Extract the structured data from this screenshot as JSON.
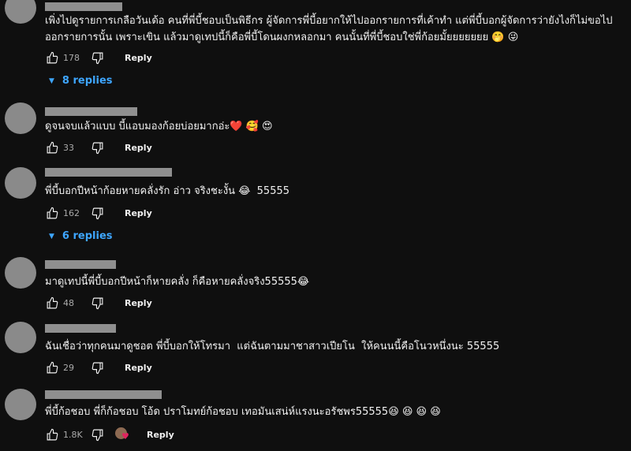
{
  "comments": [
    {
      "text": "เพิ่งไปดูรายการเกลือวันเด้อ คนที่พี่บี้ชอบเป็นพิธีกร ผู้จัดการพี่บี้อยากให้ไปออกรายการที่เค้าทำ แต่พี่บี้บอกผู้จัดการว่ายังไงก็ไม่ขอไปออกรายการนั้น เพราะเขิน แล้วมาดูเทปนี้ก็คือพี่บี้โดนผงกหลอกมา คนนั้นที่พี่บี้ชอบใช่พี่ก้อยมั้ยยยยยยย 🤭 😜",
      "likes": "178",
      "reply_label": "Reply",
      "replies_label": "8 replies"
    },
    {
      "text": "ดูจนจบแล้วแบบ บี้แอบมองก้อยบ่อยมากอ่ะ❤️ 🥰 😍",
      "likes": "33",
      "reply_label": "Reply"
    },
    {
      "text": "พี่บี้บอกปีหน้าก้อยหายคลั่งรัก อ่าว จริงชะงั้น 😂  55555",
      "likes": "162",
      "reply_label": "Reply",
      "replies_label": "6 replies"
    },
    {
      "text": "มาดูเทปนี้พี่บี้บอกปีหน้าก็หายคลั่ง ก็คือหายคลั่งจริง55555😂",
      "likes": "48",
      "reply_label": "Reply"
    },
    {
      "text": "ฉันเชื่อว่าทุกคนมาดูชอต พี่บี้บอกให้โทรมา  แต่ฉันตามมาชาสาวเปียโน  ให้คนนนี้คือโนวหนึ่งนะ 55555",
      "likes": "29",
      "reply_label": "Reply"
    },
    {
      "text": "พี่บี้ก้อชอบ พี่ก็ก้อชอบ โอ้ด ปราโมทย์ก้อชอบ เทอมันเสน่ห์แรงนะอรัชพร55555😆 😆 😆 😆",
      "likes": "1.8K",
      "reply_label": "Reply"
    }
  ],
  "icons": {
    "like": "thumbs-up-icon",
    "dislike": "thumbs-down-icon",
    "replies": "caret-down-icon",
    "creator_heart": "creator-heart-icon"
  },
  "colors": {
    "background": "#0f0f0f",
    "text": "#f1f1f1",
    "muted": "#aaaaaa",
    "link": "#3ea6ff",
    "avatar": "#8a8a8a"
  }
}
